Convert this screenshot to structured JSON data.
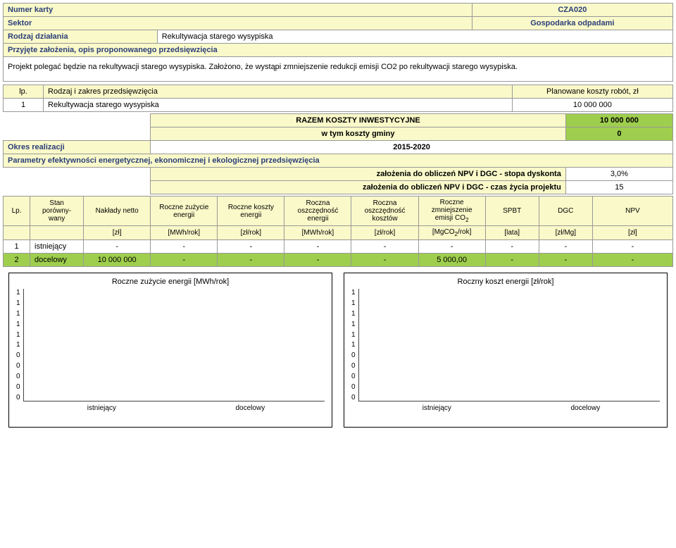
{
  "header": {
    "card_number_label": "Numer karty",
    "card_number_value": "CZA020",
    "sector_label": "Sektor",
    "sector_value": "Gospodarka odpadami",
    "action_type_label": "Rodzaj działania",
    "action_type_value": "Rekultywacja starego wysypiska",
    "assumptions_label": "Przyjęte założenia, opis proponowanego przedsięwzięcia",
    "assumptions_text": "Projekt polegać będzie na rekultywacji starego wysypiska. Założono, że wystąpi zmniejszenie redukcji emisji CO2 po rekultywacji starego wysypiska."
  },
  "scope": {
    "lp_label": "lp.",
    "scope_label": "Rodzaj i zakres przedsięwzięcia",
    "cost_label": "Planowane koszty robót, zł",
    "row1_no": "1",
    "row1_name": "Rekultywacja starego wysypiska",
    "row1_cost": "10 000 000",
    "sum_label": "RAZEM KOSZTY INWESTYCYJNE",
    "sum_value": "10 000 000",
    "muni_label": "w tym koszty gminy",
    "muni_value": "0",
    "period_label": "Okres realizacji",
    "period_value": "2015-2020",
    "params_label": "Parametry efektywności energetycznej, ekonomicznej i ekologicznej przedsięwzięcia",
    "assump_disc_label": "założenia do obliczeń NPV i DGC - stopa dyskonta",
    "assump_disc_value": "3,0%",
    "assump_life_label": "założenia do obliczeń NPV i DGC - czas życia projektu",
    "assump_life_value": "15"
  },
  "table": {
    "h_lp": "Lp.",
    "h_state": "Stan porówny-wany",
    "h_outlay": "Nakłady netto",
    "h_energy_use": "Roczne zużycie energii",
    "h_energy_cost": "Roczne koszty energii",
    "h_energy_save": "Roczna oszczędność energii",
    "h_cost_save": "Roczna oszczędność kosztów",
    "h_co2": "Roczne zmniejszenie emisji CO₂",
    "h_spbt": "SPBT",
    "h_dgc": "DGC",
    "h_npv": "NPV",
    "u_outlay": "[zł]",
    "u_energy_use": "[MWh/rok]",
    "u_energy_cost": "[zł/rok]",
    "u_energy_save": "[MWh/rok]",
    "u_cost_save": "[zł/rok]",
    "u_co2": "[MgCO₂/rok]",
    "u_spbt": "[lata]",
    "u_dgc": "[zł/Mg]",
    "u_npv": "[zł]",
    "r1": {
      "no": "1",
      "state": "istniejący",
      "outlay": "-",
      "eu": "-",
      "ec": "-",
      "es": "-",
      "cs": "-",
      "co2": "-",
      "spbt": "-",
      "dgc": "-",
      "npv": "-"
    },
    "r2": {
      "no": "2",
      "state": "docelowy",
      "outlay": "10 000 000",
      "eu": "-",
      "ec": "-",
      "es": "-",
      "cs": "-",
      "co2": "5 000,00",
      "spbt": "-",
      "dgc": "-",
      "npv": "-"
    }
  },
  "chart_data": [
    {
      "type": "bar",
      "title": "Roczne zużycie energii [MWh/rok]",
      "categories": [
        "istniejący",
        "docelowy"
      ],
      "values": [
        0,
        0
      ],
      "y_ticks": [
        "1",
        "1",
        "1",
        "1",
        "1",
        "1",
        "0",
        "0",
        "0",
        "0",
        "0"
      ]
    },
    {
      "type": "bar",
      "title": "Roczny koszt energii [zł/rok]",
      "categories": [
        "istniejący",
        "docelowy"
      ],
      "values": [
        0,
        0
      ],
      "y_ticks": [
        "1",
        "1",
        "1",
        "1",
        "1",
        "1",
        "0",
        "0",
        "0",
        "0",
        "0"
      ]
    }
  ]
}
